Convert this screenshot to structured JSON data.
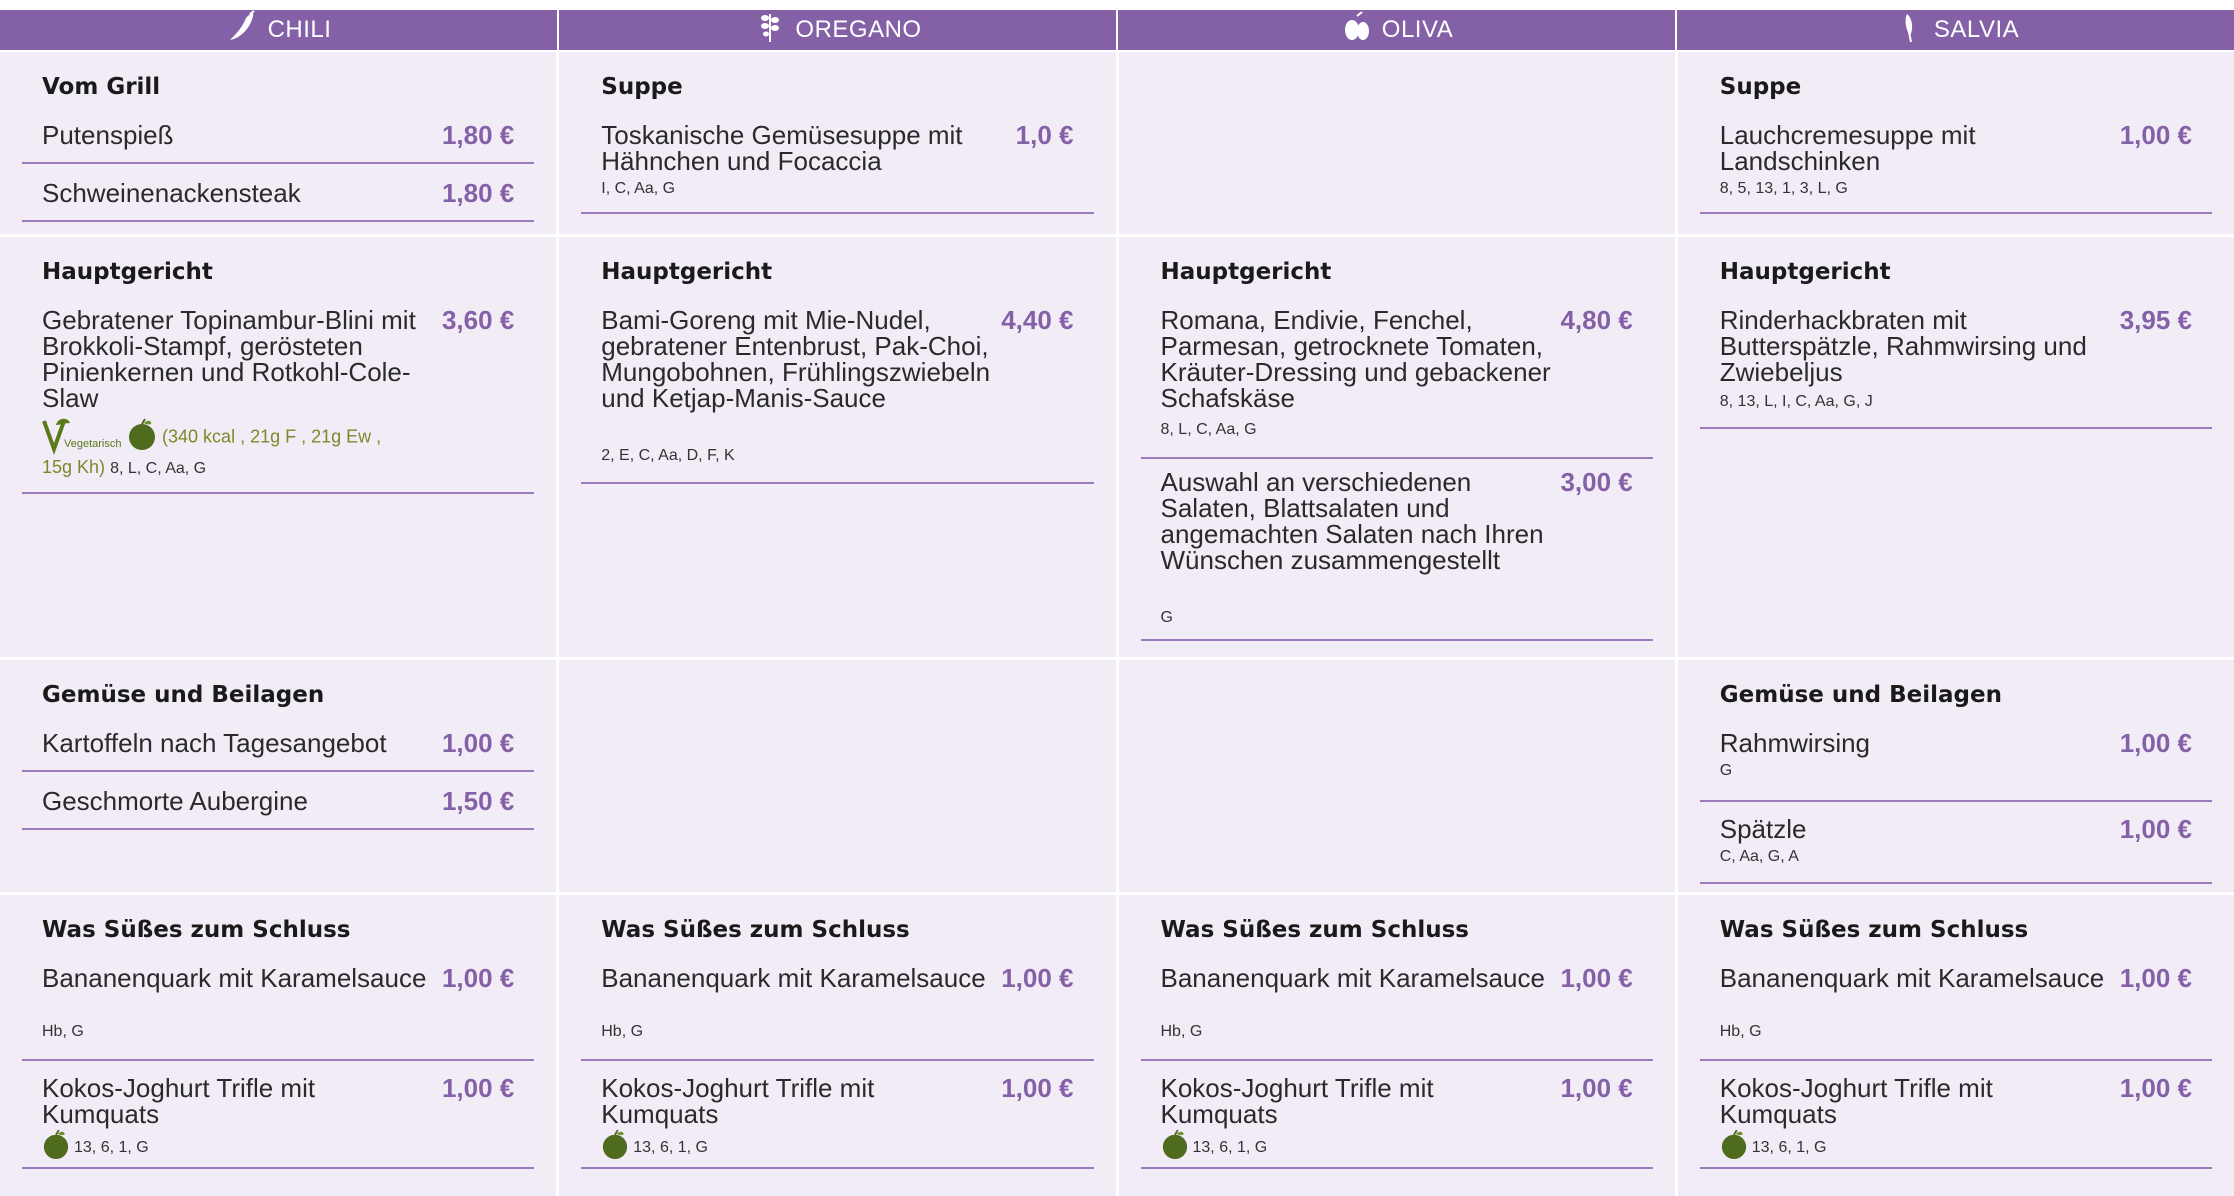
{
  "columns": [
    {
      "label": "CHILI",
      "icon": "chili-icon"
    },
    {
      "label": "OREGANO",
      "icon": "oregano-icon"
    },
    {
      "label": "OLIVA",
      "icon": "olive-icon"
    },
    {
      "label": "SALVIA",
      "icon": "sage-icon"
    }
  ],
  "colors": {
    "accent": "#8461a7",
    "cell_bg": "#f2ecf7",
    "veg_green": "#5a7a1a"
  },
  "row1": {
    "chili": {
      "title": "Vom Grill",
      "items": [
        {
          "name": "Putenspieß",
          "price": "1,80 €"
        },
        {
          "name": "Schweinenackensteak",
          "price": "1,80 €"
        }
      ]
    },
    "oregano": {
      "title": "Suppe",
      "items": [
        {
          "name": "Toskanische Gemüsesuppe mit Hähnchen und Focaccia",
          "price": "1,0 €",
          "allergens": "I, C, Aa, G"
        }
      ]
    },
    "salvia": {
      "title": "Suppe",
      "items": [
        {
          "name": "Lauchcremesuppe mit Landschinken",
          "price": "1,00 €",
          "allergens": "8, 5, 13, 1, 3, L, G"
        }
      ]
    }
  },
  "row2": {
    "chili": {
      "title": "Hauptgericht",
      "items": [
        {
          "name": "Gebratener Topinambur-Blini mit Brokkoli-Stampf, gerösteten Pinienkernen und Rotkohl-Cole-Slaw",
          "price": "3,60 €",
          "veg_label": "Vegetarisch",
          "nutrition_1": "(340 kcal , 21g F , 21g Ew ,",
          "nutrition_2": "15g Kh)",
          "allergens": "8, L, C, Aa, G"
        }
      ]
    },
    "oregano": {
      "title": "Hauptgericht",
      "items": [
        {
          "name": "Bami-Goreng mit Mie-Nudel, gebratener Entenbrust, Pak-Choi, Mungobohnen, Frühlingszwiebeln und Ketjap-Manis-Sauce",
          "price": "4,40 €",
          "allergens": "2, E, C, Aa, D, F, K"
        }
      ]
    },
    "oliva": {
      "title": "Hauptgericht",
      "items": [
        {
          "name": "Romana, Endivie, Fenchel, Parmesan, getrocknete Tomaten, Kräuter-Dressing und gebackener Schafskäse",
          "price": "4,80 €",
          "allergens": "8, L, C, Aa, G"
        },
        {
          "name": "Auswahl an verschiedenen Salaten, Blattsalaten und angemachten Salaten nach Ihren Wünschen zusammengestellt",
          "price": "3,00 €",
          "allergens": "G"
        }
      ]
    },
    "salvia": {
      "title": "Hauptgericht",
      "items": [
        {
          "name": "Rinderhackbraten mit Butterspätzle, Rahmwirsing und Zwiebeljus",
          "price": "3,95 €",
          "allergens": "8, 13, L, I, C, Aa, G, J"
        }
      ]
    }
  },
  "row3": {
    "chili": {
      "title": "Gemüse und Beilagen",
      "items": [
        {
          "name": "Kartoffeln nach Tagesangebot",
          "price": "1,00 €"
        },
        {
          "name": "Geschmorte Aubergine",
          "price": "1,50 €"
        }
      ]
    },
    "salvia": {
      "title": "Gemüse und Beilagen",
      "items": [
        {
          "name": "Rahmwirsing",
          "price": "1,00 €",
          "allergens": "G"
        },
        {
          "name": "Spätzle",
          "price": "1,00 €",
          "allergens": "C, Aa, G, A"
        }
      ]
    }
  },
  "row4": {
    "title": "Was Süßes zum Schluss",
    "item1": {
      "name": "Bananenquark mit Karamelsauce",
      "price": "1,00 €",
      "allergens": "Hb, G"
    },
    "item2": {
      "name": "Kokos-Joghurt Trifle mit Kumquats",
      "price": "1,00 €",
      "allergens": "13, 6, 1, G"
    }
  }
}
